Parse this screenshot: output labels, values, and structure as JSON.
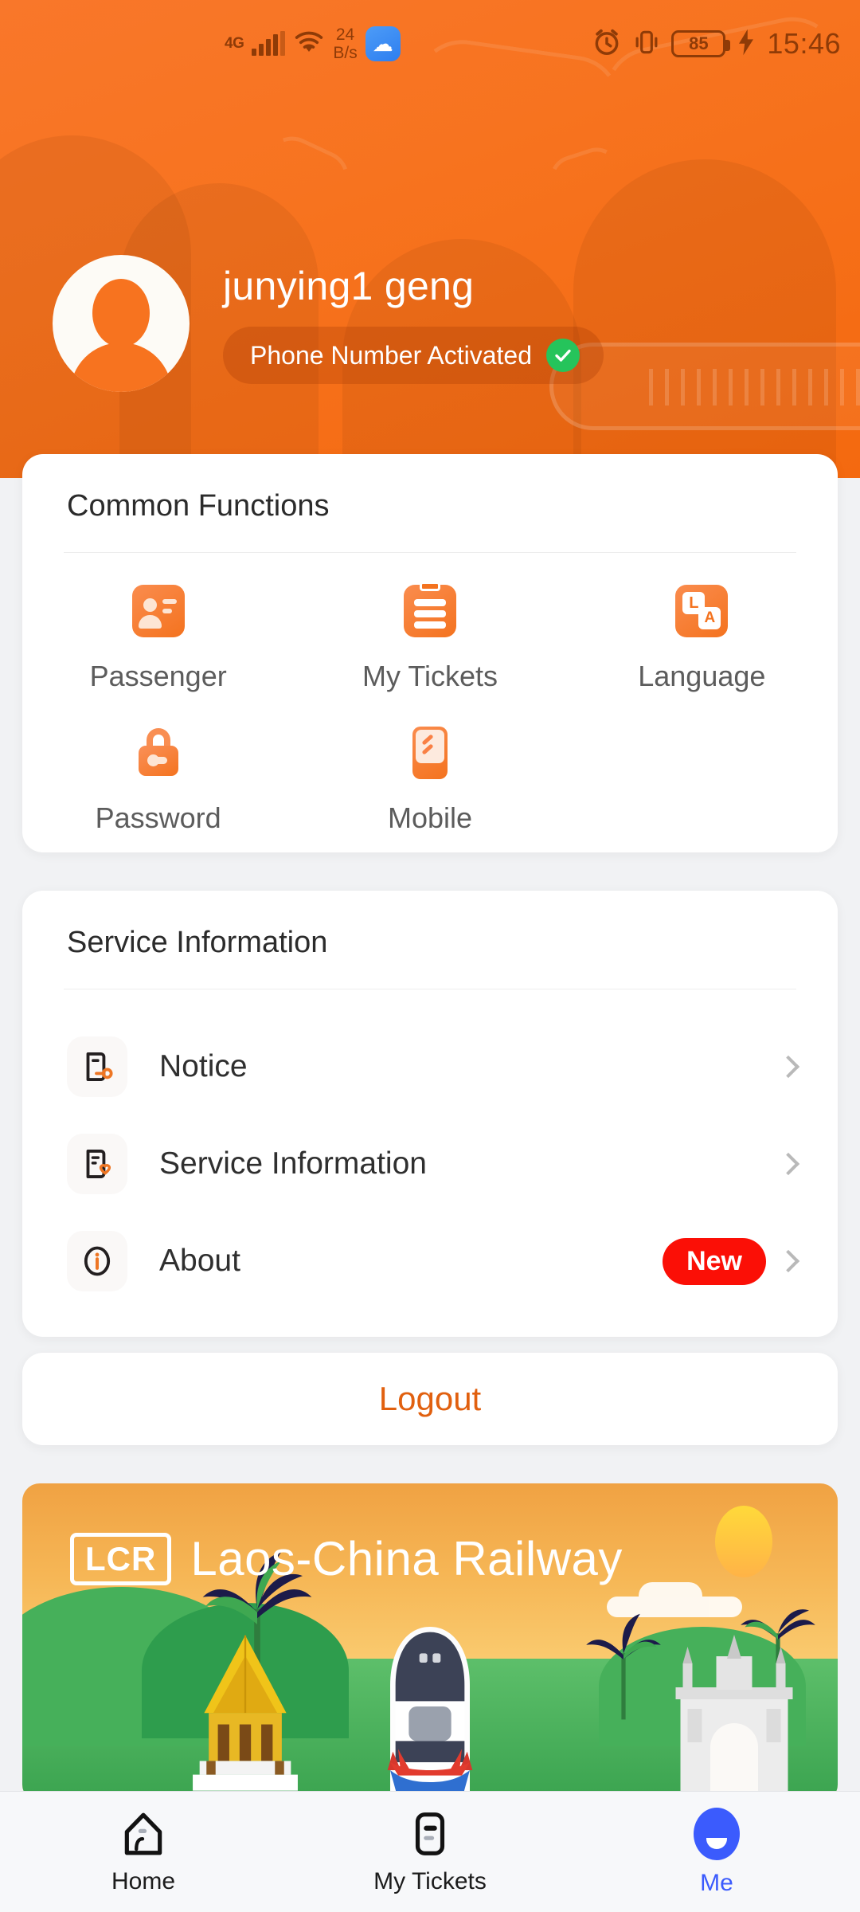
{
  "status_bar": {
    "network_type": "4G",
    "data_speed": "24",
    "data_speed_unit": "B/s",
    "battery_level": "85",
    "time": "15:46",
    "icons": [
      "signal-bars-icon",
      "wifi-icon",
      "cloud-app-icon",
      "alarm-clock-icon",
      "vibrate-icon",
      "battery-icon",
      "charging-bolt-icon"
    ]
  },
  "header": {
    "username": "junying1 geng",
    "badge_label": "Phone Number Activated",
    "badge_verified_icon": "green-check-icon",
    "accent_color": "#f7731f"
  },
  "common_functions": {
    "title": "Common Functions",
    "items": [
      {
        "label": "Passenger",
        "icon": "passenger-card-icon"
      },
      {
        "label": "My Tickets",
        "icon": "ticket-clipboard-icon"
      },
      {
        "label": "Language",
        "icon": "language-translate-icon",
        "letters": [
          "L",
          "A"
        ]
      },
      {
        "label": "Password",
        "icon": "padlock-key-icon"
      },
      {
        "label": "Mobile",
        "icon": "mobile-phone-icon"
      }
    ]
  },
  "service_information": {
    "title": "Service Information",
    "rows": [
      {
        "label": "Notice",
        "icon": "notice-document-icon",
        "badge": "",
        "chevron": "chevron-right-icon"
      },
      {
        "label": "Service Information",
        "icon": "service-heart-icon",
        "badge": "",
        "chevron": "chevron-right-icon"
      },
      {
        "label": "About",
        "icon": "info-circle-icon",
        "badge": "New",
        "chevron": "chevron-right-icon"
      }
    ],
    "badge_color": "#fb0f06"
  },
  "logout": {
    "label": "Logout",
    "color": "#e1600f"
  },
  "banner": {
    "logo_text": "LCR",
    "title": "Laos-China Railway",
    "scene": [
      "sun",
      "clouds",
      "green-hills",
      "palm-trees",
      "lao-temple",
      "high-speed-train",
      "patuxai-arch"
    ]
  },
  "tab_bar": {
    "items": [
      {
        "label": "Home",
        "icon": "home-icon",
        "active": false
      },
      {
        "label": "My Tickets",
        "icon": "ticket-icon",
        "active": false
      },
      {
        "label": "Me",
        "icon": "profile-icon",
        "active": true
      }
    ],
    "active_color": "#3b5bfd"
  }
}
